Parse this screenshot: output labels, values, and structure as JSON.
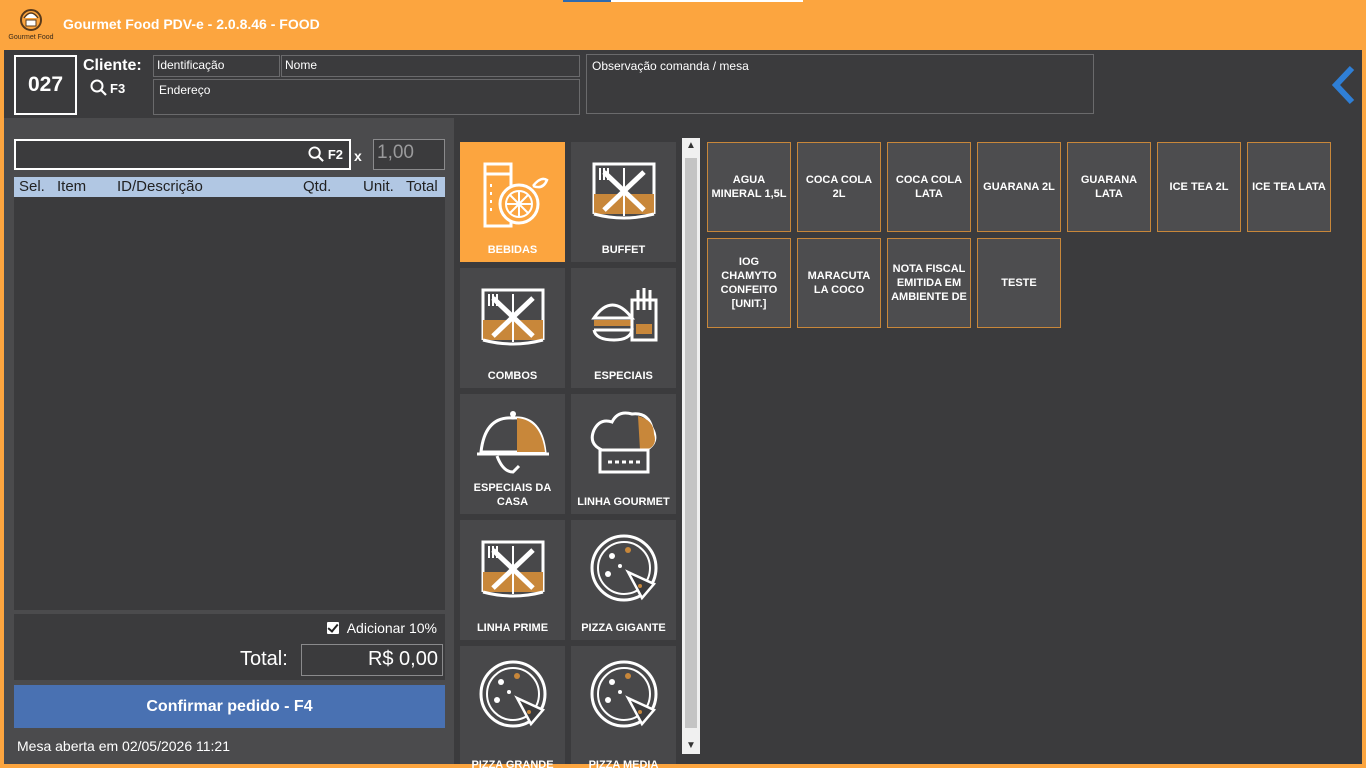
{
  "app": {
    "title": "Gourmet Food PDV-e - 2.0.8.46 - FOOD",
    "logo_text": "Gourmet Food"
  },
  "header": {
    "mesa_number": "027",
    "cliente_label": "Cliente:",
    "cliente_search_shortcut": "F3",
    "identificacao_placeholder": "Identificação",
    "nome_placeholder": "Nome",
    "endereco_placeholder": "Endereço",
    "observacao_placeholder": "Observação comanda / mesa"
  },
  "order": {
    "search_shortcut": "F2",
    "multiply_label": "x",
    "quantity_value": "1,00",
    "columns": [
      "Sel.",
      "Item",
      "ID/Descrição",
      "Qtd.",
      "Unit.",
      "Total"
    ],
    "add_10_label": "Adicionar 10%",
    "add_10_checked": true,
    "total_label": "Total:",
    "total_value": "R$ 0,00",
    "confirm_label": "Confirmar pedido - F4",
    "mesa_aberta": "Mesa aberta em 02/05/2026 11:21"
  },
  "categories": [
    {
      "label": "BEBIDAS",
      "icon": "drinks-icon",
      "active": true
    },
    {
      "label": "BUFFET",
      "icon": "buffet-icon",
      "active": false
    },
    {
      "label": "COMBOS",
      "icon": "cutlery-book-icon",
      "active": false
    },
    {
      "label": "ESPECIAIS",
      "icon": "burger-fries-icon",
      "active": false
    },
    {
      "label": "ESPECIAIS DA CASA",
      "icon": "cloche-icon",
      "active": false
    },
    {
      "label": "LINHA GOURMET",
      "icon": "chef-hat-icon",
      "active": false
    },
    {
      "label": "LINHA PRIME",
      "icon": "cutlery-book-icon",
      "active": false
    },
    {
      "label": "PIZZA GIGANTE",
      "icon": "pizza-icon",
      "active": false
    },
    {
      "label": "PIZZA GRANDE",
      "icon": "pizza-icon",
      "active": false
    },
    {
      "label": "PIZZA MEDIA",
      "icon": "pizza-icon",
      "active": false
    }
  ],
  "products": [
    "AGUA MINERAL 1,5L",
    "COCA COLA 2L",
    "COCA COLA LATA",
    "GUARANA 2L",
    "GUARANA LATA",
    "ICE TEA 2L",
    "ICE TEA LATA",
    "IOG CHAMYTO CONFEITO [UNIT.]",
    "MARACUTA LA COCO",
    "NOTA FISCAL EMITIDA EM AMBIENTE DE",
    "TESTE"
  ],
  "colors": {
    "accent": "#fca53f",
    "panel": "#3b3b3d",
    "confirm": "#4971b2",
    "product_border": "#c8873a",
    "back_arrow": "#2f7fd6"
  }
}
